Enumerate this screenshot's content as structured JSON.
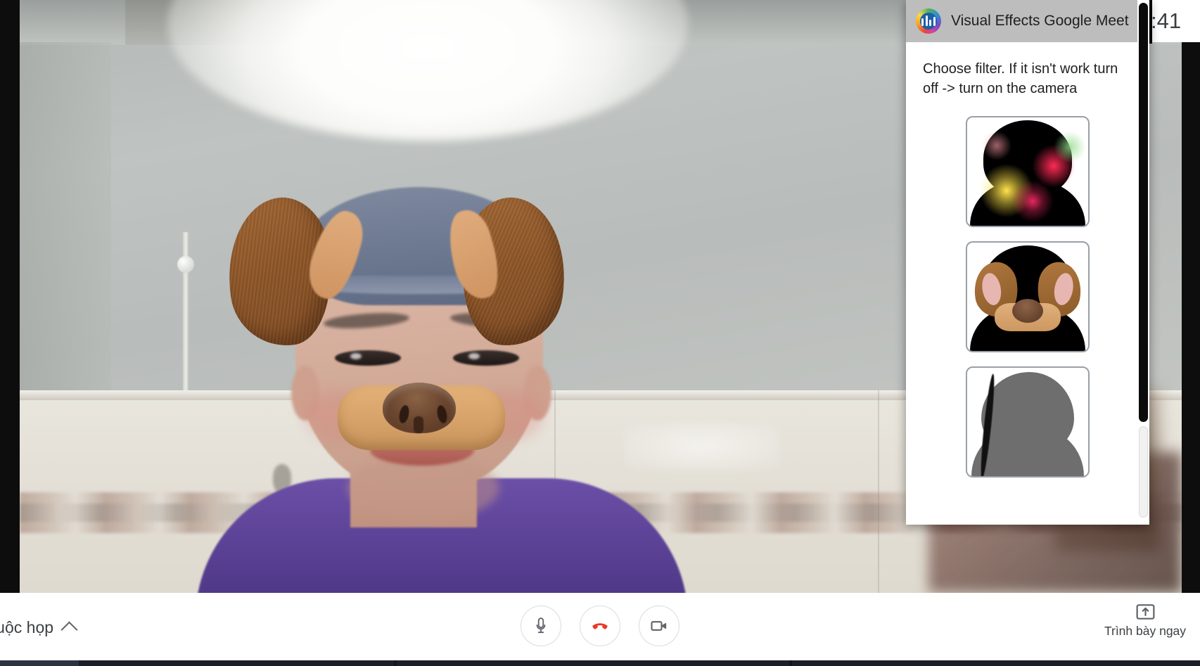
{
  "app": {
    "name": "Google Meet",
    "platform": "web-video-call"
  },
  "clock": {
    "time": ":41"
  },
  "video": {
    "participant_label": "",
    "applied_filter": "dog-ears-and-nose",
    "scene_description": "person wearing backwards cap in tiled bathroom with overhead light"
  },
  "popup": {
    "title": "Visual Effects Google Meet",
    "logo_icon": "visual-effects-logo-icon",
    "instruction": "Choose filter. If it isn't work turn off -> turn on the camera",
    "filters": [
      {
        "id": "fireworks",
        "name": "fireworks-silhouette-filter",
        "label": ""
      },
      {
        "id": "dog",
        "name": "dog-face-filter",
        "label": ""
      },
      {
        "id": "silhouette",
        "name": "gray-silhouette-filter",
        "label": ""
      }
    ],
    "scrollbar": {
      "name": "popup-scrollbar"
    }
  },
  "controlbar": {
    "meeting_info_label": "về cuộc họp",
    "meeting_info_chevron": "chevron-up-icon",
    "buttons": [
      {
        "id": "mic",
        "name": "microphone-button",
        "icon": "microphone-icon",
        "label": ""
      },
      {
        "id": "hangup",
        "name": "hang-up-button",
        "icon": "phone-hangup-icon",
        "label": ""
      },
      {
        "id": "camera",
        "name": "camera-button",
        "icon": "video-camera-icon",
        "label": ""
      }
    ],
    "present_now": {
      "label": "Trình bày ngay",
      "icon": "present-screen-icon"
    }
  },
  "colors": {
    "hangup_red": "#e8392b",
    "popup_header_gray": "#bdbdbd",
    "control_text": "#3c4043",
    "border_gray": "#dadce0"
  }
}
